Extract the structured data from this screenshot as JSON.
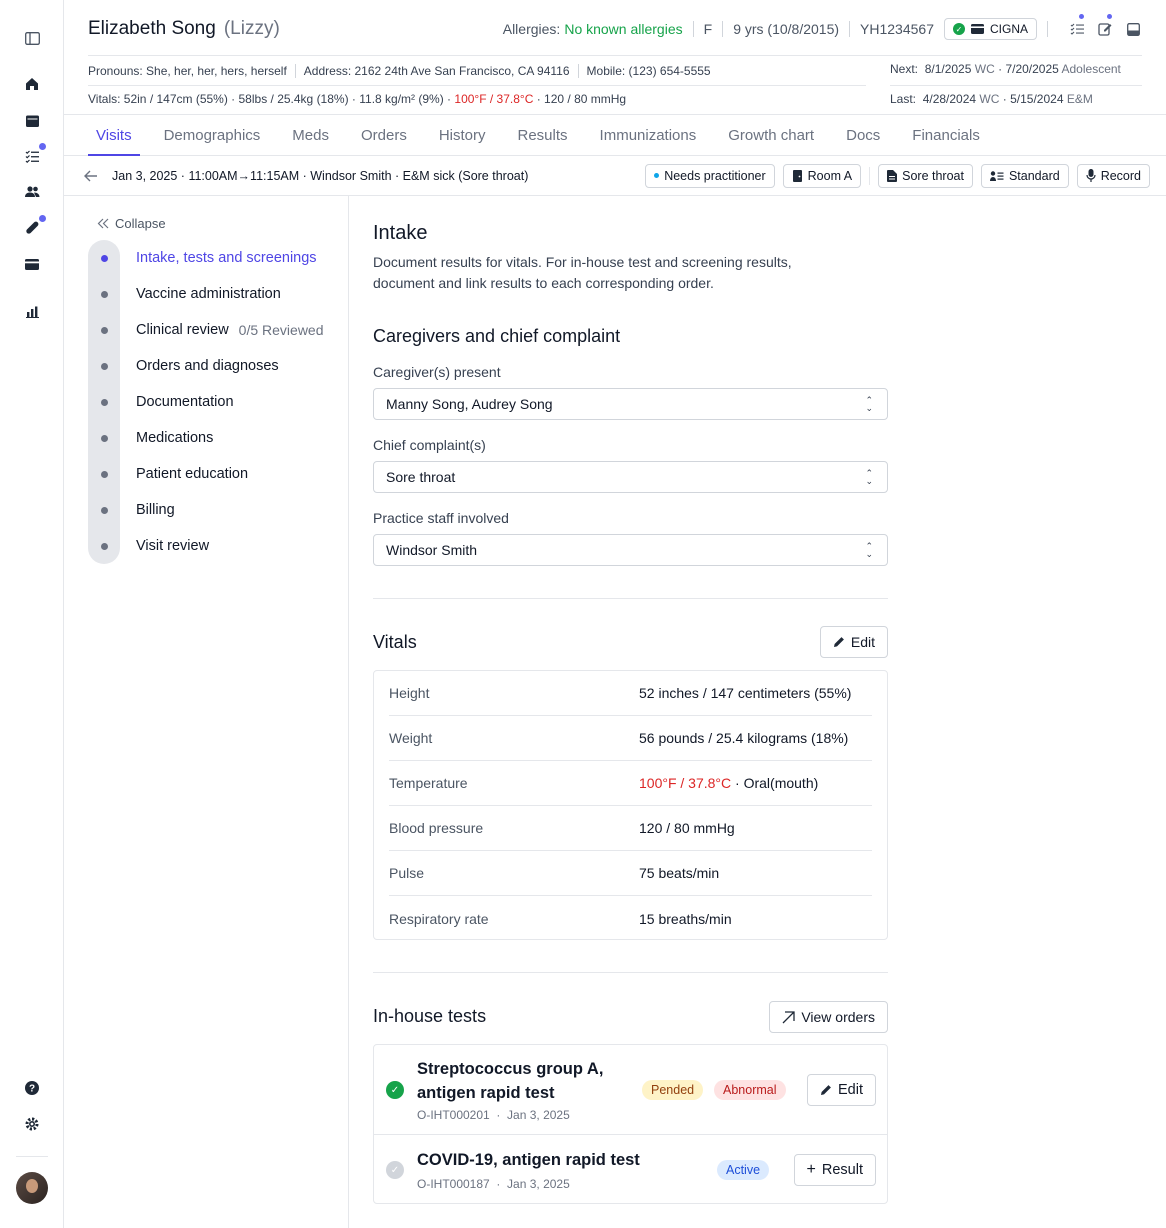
{
  "patient": {
    "name": "Elizabeth Song",
    "nickname": "(Lizzy)",
    "allergies_label": "Allergies:",
    "allergies_value": "No known allergies",
    "sex": "F",
    "age": "9 yrs (10/8/2015)",
    "mrn": "YH1234567",
    "insurance": "CIGNA",
    "pronouns": "Pronouns: She, her, her, hers, herself",
    "address": "Address: 2162 24th Ave San Francisco, CA 94116",
    "mobile": "Mobile: (123) 654-5555",
    "vitals_summary_a": "Vitals: 52in / 147cm (55%) · 58lbs / 25.4kg (18%) · 11.8 kg/m² (9%) ·",
    "vitals_summary_temp": "100°F / 37.8°C",
    "vitals_summary_b": "· 120 / 80 mmHg",
    "next_label": "Next:",
    "next_date1": "8/1/2025",
    "next_type1": "WC",
    "next_sep": "·",
    "next_date2": "7/20/2025",
    "next_type2": "Adolescent",
    "last_label": "Last:",
    "last_date1": "4/28/2024",
    "last_type1": "WC",
    "last_sep": "·",
    "last_date2": "5/15/2024",
    "last_type2": "E&M"
  },
  "tabs": [
    "Visits",
    "Demographics",
    "Meds",
    "Orders",
    "History",
    "Results",
    "Immunizations",
    "Growth chart",
    "Docs",
    "Financials"
  ],
  "visit": {
    "info": "Jan 3, 2025 · 11:00AM→11:15AM · Windsor Smith · E&M sick (Sore throat)",
    "status": "Needs practitioner",
    "room": "Room A",
    "complaint": "Sore throat",
    "visit_type": "Standard",
    "record": "Record"
  },
  "sidenav": {
    "collapse": "Collapse",
    "steps": [
      {
        "label": "Intake, tests and screenings",
        "extra": ""
      },
      {
        "label": "Vaccine administration",
        "extra": ""
      },
      {
        "label": "Clinical review",
        "extra": "0/5 Reviewed"
      },
      {
        "label": "Orders and diagnoses",
        "extra": ""
      },
      {
        "label": "Documentation",
        "extra": ""
      },
      {
        "label": "Medications",
        "extra": ""
      },
      {
        "label": "Patient education",
        "extra": ""
      },
      {
        "label": "Billing",
        "extra": ""
      },
      {
        "label": "Visit review",
        "extra": ""
      }
    ]
  },
  "intake": {
    "title": "Intake",
    "description": "Document results for vitals. For in-house test and screening results, document and link results to each corresponding order.",
    "caregivers_heading": "Caregivers and chief complaint",
    "caregivers_label": "Caregiver(s) present",
    "caregivers_value": "Manny Song, Audrey Song",
    "complaint_label": "Chief complaint(s)",
    "complaint_value": "Sore throat",
    "staff_label": "Practice staff involved",
    "staff_value": "Windsor Smith"
  },
  "vitals": {
    "heading": "Vitals",
    "edit": "Edit",
    "rows": [
      {
        "label": "Height",
        "value": "52 inches / 147 centimeters (55%)"
      },
      {
        "label": "Weight",
        "value": "56 pounds / 25.4 kilograms (18%)"
      },
      {
        "label": "Temperature",
        "value_red": "100°F / 37.8°C",
        "value": " · Oral(mouth)"
      },
      {
        "label": "Blood pressure",
        "value": "120 / 80 mmHg"
      },
      {
        "label": "Pulse",
        "value": "75 beats/min"
      },
      {
        "label": "Respiratory rate",
        "value": "15 breaths/min"
      }
    ]
  },
  "tests": {
    "heading": "In-house tests",
    "view_orders": "View orders",
    "items": [
      {
        "name": "Streptococcus group A, antigen rapid test",
        "id": "O-IHT000201",
        "date": "Jan 3, 2025",
        "badges": [
          "Pended",
          "Abnormal"
        ],
        "action": "Edit"
      },
      {
        "name": "COVID-19, antigen rapid test",
        "id": "O-IHT000187",
        "date": "Jan 3, 2025",
        "badges": [
          "Active"
        ],
        "action": "Result"
      }
    ],
    "meta_sep": "·"
  },
  "colors": {
    "accent": "#4f46e5",
    "green": "#16a34a",
    "red": "#dc2626"
  }
}
